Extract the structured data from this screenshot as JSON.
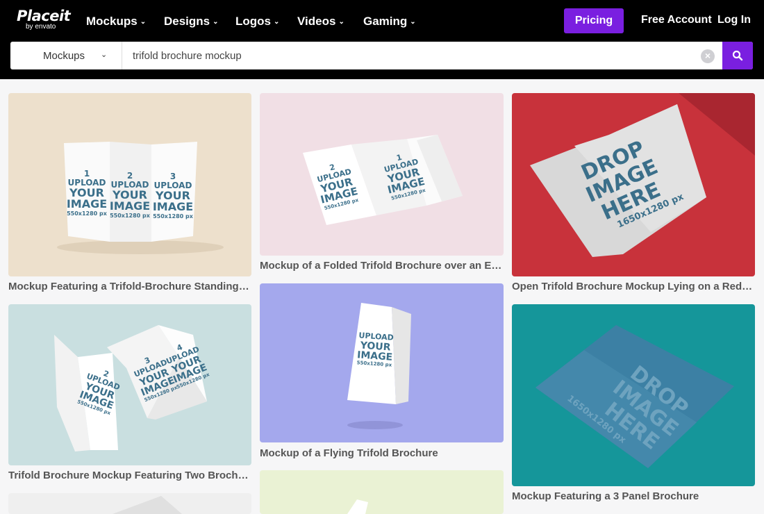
{
  "brand": {
    "name": "Placeit",
    "sub": "by envato"
  },
  "nav": [
    {
      "label": "Mockups"
    },
    {
      "label": "Designs"
    },
    {
      "label": "Logos"
    },
    {
      "label": "Videos"
    },
    {
      "label": "Gaming"
    }
  ],
  "header": {
    "pricing": "Pricing",
    "free_account": "Free Account",
    "login": "Log In"
  },
  "search": {
    "category": "Mockups",
    "query": "trifold brochure mockup"
  },
  "results": [
    {
      "title": "Mockup Featuring a Trifold-Brochure Standing A...",
      "bg": "#ede0cc",
      "panels": [
        {
          "num": "1",
          "line1": "UPLOAD",
          "line2": "YOUR",
          "line3": "IMAGE",
          "size": "550x1280 px"
        },
        {
          "num": "2",
          "line1": "UPLOAD",
          "line2": "YOUR",
          "line3": "IMAGE",
          "size": "550x1280 px"
        },
        {
          "num": "3",
          "line1": "UPLOAD",
          "line2": "YOUR",
          "line3": "IMAGE",
          "size": "550x1280 px"
        }
      ]
    },
    {
      "title": "Mockup of a Folded Trifold Brochure over an Exte...",
      "bg": "#f1dfe5",
      "panels": [
        {
          "num": "2",
          "line1": "UPLOAD",
          "line2": "YOUR",
          "line3": "IMAGE",
          "size": "550x1280 px"
        },
        {
          "num": "1",
          "line1": "UPLOAD",
          "line2": "YOUR",
          "line3": "IMAGE",
          "size": "550x1280 px"
        }
      ]
    },
    {
      "title": "Open Trifold Brochure Mockup Lying on a Red Su...",
      "bg": "#c8323b",
      "drop": {
        "line1": "DROP",
        "line2": "IMAGE",
        "line3": "HERE",
        "size": "1650x1280 px"
      }
    },
    {
      "title": "Trifold Brochure Mockup Featuring Two Brochur...",
      "bg": "#c9dfe0",
      "panels": [
        {
          "num": "2",
          "line1": "UPLOAD",
          "line2": "YOUR",
          "line3": "IMAGE",
          "size": "550x1280 px"
        },
        {
          "num": "3",
          "line1": "UPLOAD",
          "line2": "YOUR",
          "line3": "IMAGE",
          "size": "550x1280 px"
        },
        {
          "num": "4",
          "line1": "UPLOAD",
          "line2": "YOUR",
          "line3": "IMAGE",
          "size": "550x1280 px"
        }
      ]
    },
    {
      "title": "Mockup of a Flying Trifold Brochure",
      "bg": "#a4a8ed",
      "panels": [
        {
          "num": "",
          "line1": "UPLOAD",
          "line2": "YOUR",
          "line3": "IMAGE",
          "size": "550x1280 px"
        }
      ]
    },
    {
      "title": "Mockup Featuring a 3 Panel Brochure",
      "bg": "#15969a",
      "drop": {
        "line1": "DROP",
        "line2": "IMAGE",
        "line3": "HERE",
        "size": "1650x1280 px"
      }
    },
    {
      "title": "",
      "bg": "#efefef"
    },
    {
      "title": "",
      "bg": "#eaf2d4"
    }
  ],
  "colors": {
    "accent": "#7a1fe0",
    "header_bg": "#000000",
    "mock_text": "#3b6f8a"
  },
  "icons": {
    "search": "search-icon",
    "clear": "clear-icon",
    "chevron": "chevron-down-icon"
  }
}
